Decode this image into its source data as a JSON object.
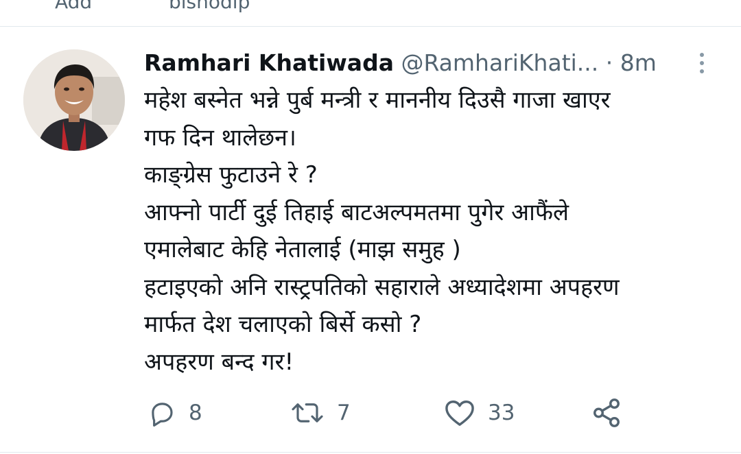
{
  "top_partial": {
    "left_label": "Add",
    "right_label": "bishodip"
  },
  "tweet": {
    "author_name": "Ramhari Khatiwada",
    "handle": "@RamhariKhati...",
    "separator": "·",
    "time": "8m",
    "text": "महेश  बस्नेत भन्ने पुर्ब मन्त्री  र माननीय दिउसै गाजा खाएर\nगफ दिन थालेछन।\nकाङ्ग्रेस फुटाउने रे ?\nआफ्नो पार्टी  दुई तिहाई बाटअल्पमतमा पुगेर  आफैंले\nएमालेबाट केहि नेतालाई  (माझ समुह )\nहटाइएको अनि रास्ट्रपतिको सहाराले अध्यादेशमा अपहरण\nमार्फत देश चलाएको बिर्से कसो ?\nअपहरण बन्द गर!",
    "actions": {
      "replies": "8",
      "retweets": "7",
      "likes": "33"
    }
  },
  "icons": {
    "reply": "reply-icon",
    "retweet": "retweet-icon",
    "like": "heart-icon",
    "share": "share-icon",
    "more": "more-vertical-icon"
  },
  "colors": {
    "text": "#0f1419",
    "secondary": "#536471",
    "divider": "#e1e8ed"
  }
}
